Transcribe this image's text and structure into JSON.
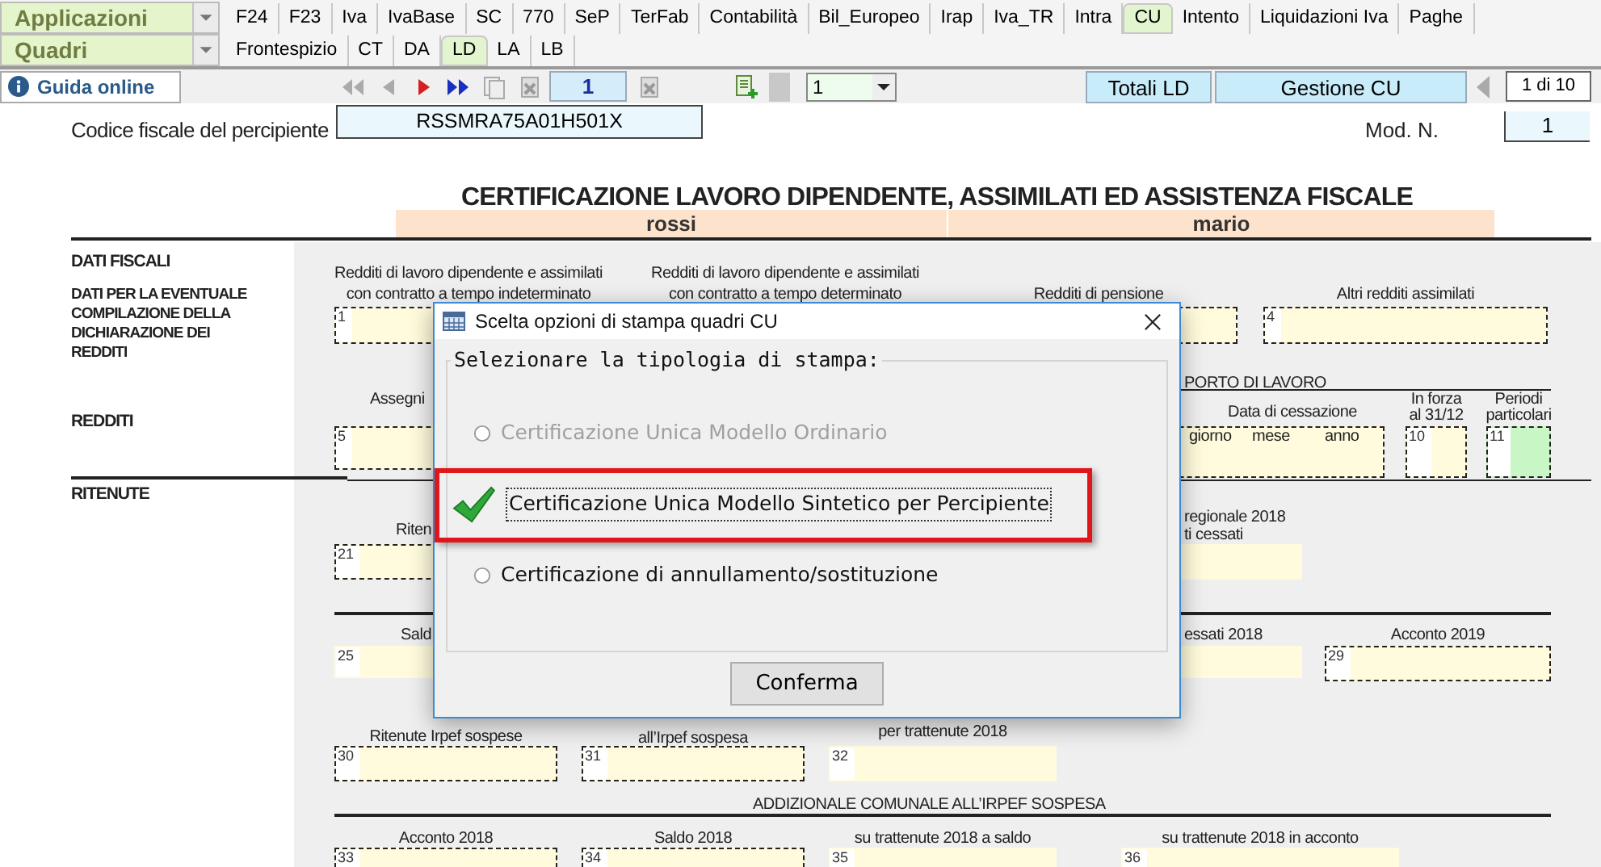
{
  "dropdowns": [
    {
      "label": "Applicazioni"
    },
    {
      "label": "Quadri"
    }
  ],
  "app_tabs": [
    {
      "label": "F24",
      "selected": false
    },
    {
      "label": "F23",
      "selected": false
    },
    {
      "label": "Iva",
      "selected": false
    },
    {
      "label": "IvaBase",
      "selected": false
    },
    {
      "label": "SC",
      "selected": false
    },
    {
      "label": "770",
      "selected": false
    },
    {
      "label": "SeP",
      "selected": false
    },
    {
      "label": "TerFab",
      "selected": false
    },
    {
      "label": "Contabilità",
      "selected": false
    },
    {
      "label": "Bil_Europeo",
      "selected": false
    },
    {
      "label": "Irap",
      "selected": false
    },
    {
      "label": "Iva_TR",
      "selected": false
    },
    {
      "label": "Intra",
      "selected": false
    },
    {
      "label": "CU",
      "selected": true
    },
    {
      "label": "Intento",
      "selected": false
    },
    {
      "label": "Liquidazioni Iva",
      "selected": false
    },
    {
      "label": "Paghe",
      "selected": false
    }
  ],
  "quadri_tabs": [
    {
      "label": "Frontespizio",
      "selected": false
    },
    {
      "label": "CT",
      "selected": false
    },
    {
      "label": "DA",
      "selected": false
    },
    {
      "label": "LD",
      "selected": true
    },
    {
      "label": "LA",
      "selected": false
    },
    {
      "label": "LB",
      "selected": false
    }
  ],
  "toolbar": {
    "help_button": "Guida online",
    "page": "1",
    "select_value": "1",
    "buttons": [
      "Totali LD",
      "Gestione CU"
    ],
    "page_counter": "1 di 10"
  },
  "form": {
    "codice_label": "Codice fiscale del percipiente",
    "codice_value": "RSSMRA75A01H501X",
    "mod_label": "Mod. N.",
    "mod_value": "1",
    "title": "CERTIFICAZIONE LAVORO DIPENDENTE, ASSIMILATI ED ASSISTENZA FISCALE",
    "surname": "rossi",
    "name": "mario",
    "sections": [
      "DATI FISCALI",
      "DATI PER LA EVENTUALE COMPILAZIONE DELLA DICHIARAZIONE DEI REDDITI",
      "REDDITI",
      "RITENUTE"
    ],
    "captions": [
      "Redditi di lavoro dipendente e assimilati",
      "con contratto a tempo indeterminato",
      "Redditi di lavoro dipendente e assimilati",
      "con contratto a tempo determinato",
      "Redditi di pensione",
      "Altri redditi assimilati",
      "Assegni",
      "PORTO DI LAVORO",
      "Data di cessazione",
      "giorno",
      "mese",
      "anno",
      "In forza",
      "al 31/12",
      "Periodi",
      "particolari",
      "Riten",
      "regionale 2018",
      "ti cessati",
      "Sald",
      "essati 2018",
      "Acconto 2019",
      "Ritenute Irpef sospese",
      "all’Irpef sospesa",
      "per trattenute 2018",
      "ADDIZIONALE COMUNALE ALL’IRPEF SOSPESA",
      "Acconto 2018",
      "Saldo 2018",
      "su trattenute 2018 a saldo",
      "su trattenute 2018 in acconto"
    ],
    "fields": [
      {
        "number": "1",
        "kind": "dashed",
        "color": "#fffbdc"
      },
      {
        "kind": "dashed",
        "color": "#fffbdc"
      },
      {
        "number": "4",
        "kind": "dashed",
        "color": "#fffbdc"
      },
      {
        "number": "5",
        "kind": "dashed",
        "color": "#fffbdc"
      },
      {
        "kind": "dashed",
        "color": "#fffbdc"
      },
      {
        "number": "10",
        "kind": "dashed",
        "color": "#fffbdc"
      },
      {
        "number": "11",
        "kind": "dashed",
        "color": "#c8f7c5"
      },
      {
        "number": "21",
        "kind": "dashed",
        "color": "#fffbdc"
      },
      {
        "kind": "plain",
        "color": "#fffbdc"
      },
      {
        "number": "25",
        "kind": "plain",
        "color": "#fffbdc"
      },
      {
        "kind": "plain",
        "color": "#fffbdc"
      },
      {
        "number": "29",
        "kind": "dashed",
        "color": "#fffbdc"
      },
      {
        "number": "30",
        "kind": "dashed",
        "color": "#fffbdc"
      },
      {
        "number": "31",
        "kind": "dashed",
        "color": "#fffbdc"
      },
      {
        "number": "32",
        "kind": "plain",
        "color": "#fffbdc"
      },
      {
        "number": "33",
        "kind": "dashed",
        "color": "#fffbdc"
      },
      {
        "number": "34",
        "kind": "dashed",
        "color": "#fffbdc"
      },
      {
        "number": "35",
        "kind": "plain",
        "color": "#fffbdc"
      },
      {
        "number": "36",
        "kind": "plain",
        "color": "#fffbdc"
      }
    ]
  },
  "dialog": {
    "title": "Scelta opzioni di stampa quadri CU",
    "group_label": "Selezionare la tipologia di stampa:",
    "options": [
      {
        "label": "Certificazione Unica Modello Ordinario",
        "selected": false,
        "disabled": true,
        "highlighted": false
      },
      {
        "label": "Certificazione Unica Modello Sintetico per Percipiente",
        "selected": true,
        "disabled": false,
        "highlighted": true
      },
      {
        "label": "Certificazione di annullamento/sostituzione",
        "selected": false,
        "disabled": false,
        "highlighted": false
      }
    ],
    "confirm_button": "Conferma"
  }
}
